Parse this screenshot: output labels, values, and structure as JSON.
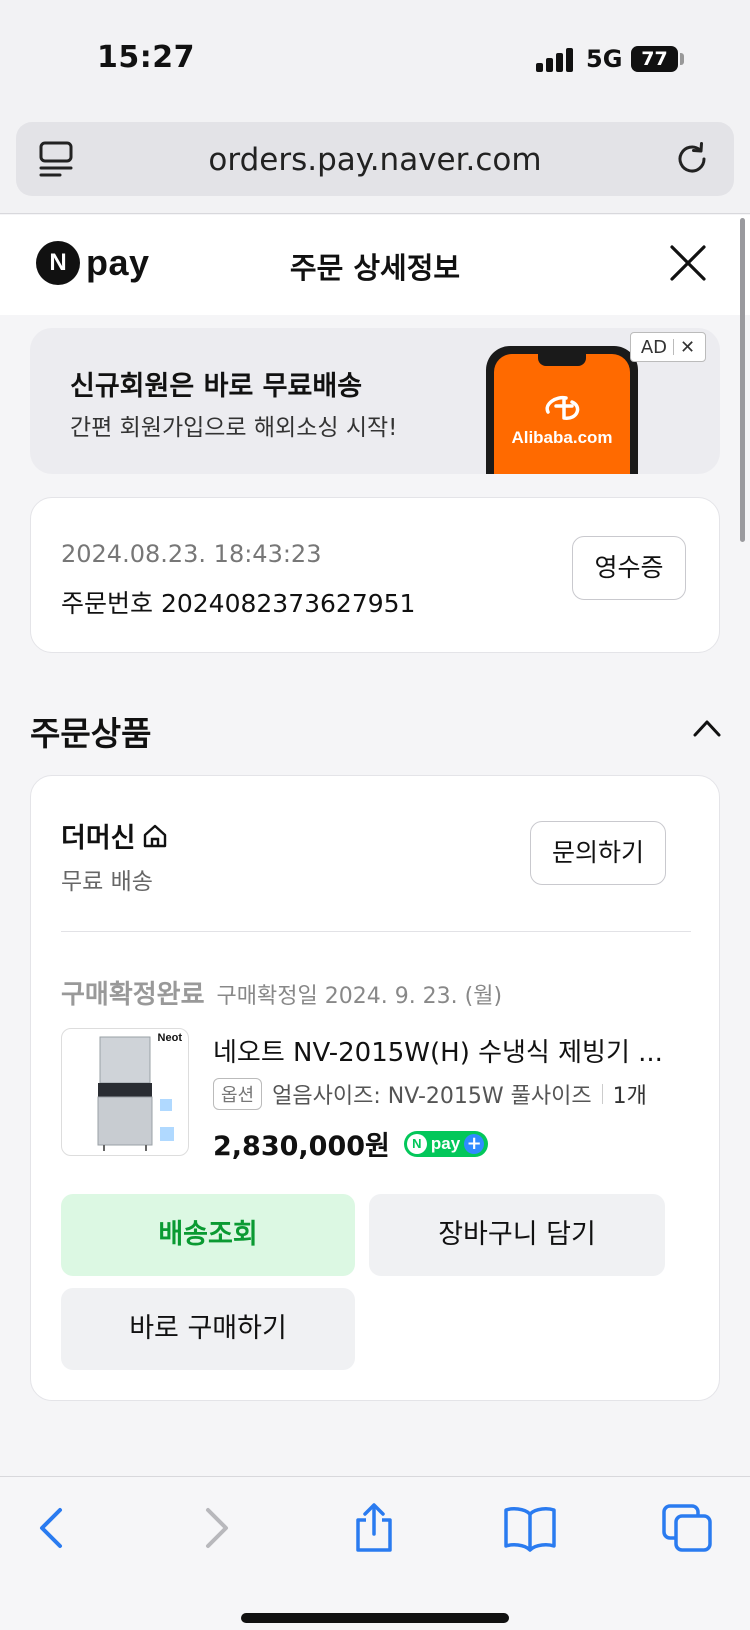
{
  "status_bar": {
    "time": "15:27",
    "network": "5G",
    "battery": "77"
  },
  "browser": {
    "url": "orders.pay.naver.com"
  },
  "header": {
    "logo_n": "N",
    "logo_word": "pay",
    "title": "주문 상세정보"
  },
  "ad": {
    "headline": "신규회원은 바로 무료배송",
    "sub": "간편 회원가입으로 해외소싱 시작!",
    "brand": "Alibaba.com",
    "badge": "AD",
    "badge_close": "✕"
  },
  "order": {
    "date": "2024.08.23. 18:43:23",
    "number": "주문번호 2024082373627951",
    "receipt_label": "영수증"
  },
  "section": {
    "title": "주문상품"
  },
  "seller": {
    "name": "더머신",
    "shipping": "무료 배송",
    "inquiry_label": "문의하기"
  },
  "product": {
    "status": "구매확정완료",
    "confirm_date": "구매확정일 2024. 9. 23. (월)",
    "thumb_brand": "Neot",
    "name": "네오트 NV-2015W(H) 수냉식 제빙기 ...",
    "option_tag": "옵션",
    "option": "얼음사이즈: NV-2015W 풀사이즈",
    "quantity": "1개",
    "price": "2,830,000원",
    "npay_n": "N",
    "npay_word": "pay",
    "npay_plus": "+"
  },
  "actions": {
    "track": "배송조회",
    "cart": "장바구니 담기",
    "buy": "바로 구매하기"
  },
  "icons": {
    "back": "chevron-left-icon",
    "forward": "chevron-right-icon",
    "share": "share-icon",
    "bookmarks": "book-icon",
    "tabs": "tabs-icon"
  },
  "colors": {
    "accent_green": "#0a9a32",
    "track_bg": "#dcf8e3",
    "ios_blue": "#2a7bf0",
    "alibaba_orange": "#ff6a00"
  }
}
